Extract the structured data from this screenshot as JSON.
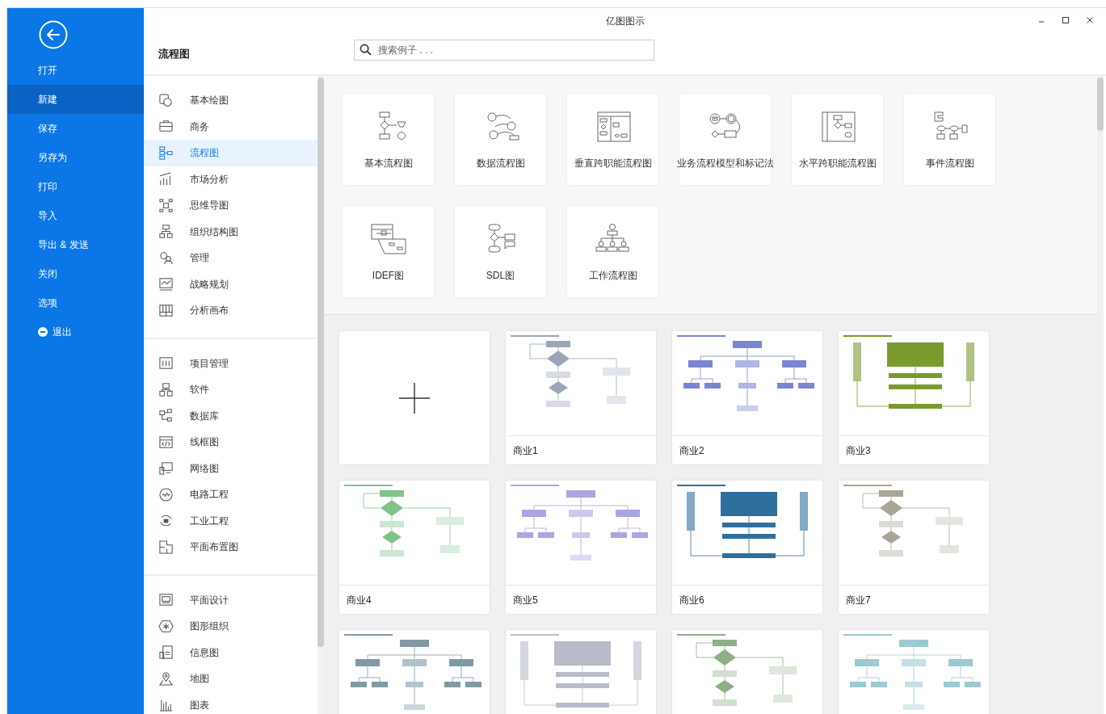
{
  "window": {
    "title": "亿图图示"
  },
  "sidebar": {
    "items": [
      {
        "label": "打开",
        "selected": false,
        "kind": "plain"
      },
      {
        "label": "新建",
        "selected": true,
        "kind": "plain"
      },
      {
        "label": "保存",
        "selected": false,
        "kind": "plain"
      },
      {
        "label": "另存为",
        "selected": false,
        "kind": "plain"
      },
      {
        "label": "打印",
        "selected": false,
        "kind": "plain"
      },
      {
        "label": "导入",
        "selected": false,
        "kind": "plain"
      },
      {
        "label": "导出 & 发送",
        "selected": false,
        "kind": "plain"
      },
      {
        "label": "关闭",
        "selected": false,
        "kind": "plain"
      },
      {
        "label": "选项",
        "selected": false,
        "kind": "plain"
      },
      {
        "label": "退出",
        "selected": false,
        "kind": "exit"
      }
    ]
  },
  "header": {
    "title": "流程图"
  },
  "search": {
    "placeholder": "搜索例子 . . ."
  },
  "category_groups": [
    {
      "items": [
        {
          "label": "基本绘图",
          "selected": false
        },
        {
          "label": "商务",
          "selected": false
        },
        {
          "label": "流程图",
          "selected": true
        },
        {
          "label": "市场分析",
          "selected": false
        },
        {
          "label": "思维导图",
          "selected": false
        },
        {
          "label": "组织结构图",
          "selected": false
        },
        {
          "label": "管理",
          "selected": false
        },
        {
          "label": "战略规划",
          "selected": false
        },
        {
          "label": "分析画布",
          "selected": false
        }
      ]
    },
    {
      "items": [
        {
          "label": "项目管理",
          "selected": false
        },
        {
          "label": "软件",
          "selected": false
        },
        {
          "label": "数据库",
          "selected": false
        },
        {
          "label": "线框图",
          "selected": false
        },
        {
          "label": "网络图",
          "selected": false
        },
        {
          "label": "电路工程",
          "selected": false
        },
        {
          "label": "工业工程",
          "selected": false
        },
        {
          "label": "平面布置图",
          "selected": false
        }
      ]
    },
    {
      "items": [
        {
          "label": "平面设计",
          "selected": false
        },
        {
          "label": "图形组织",
          "selected": false
        },
        {
          "label": "信息图",
          "selected": false
        },
        {
          "label": "地图",
          "selected": false
        },
        {
          "label": "图表",
          "selected": false
        }
      ]
    }
  ],
  "diagram_types": [
    {
      "label": "基本流程图"
    },
    {
      "label": "数据流程图"
    },
    {
      "label": "垂直跨职能流程图"
    },
    {
      "label": "业务流程模型和标记法"
    },
    {
      "label": "水平跨职能流程图"
    },
    {
      "label": "事件流程图"
    },
    {
      "label": "IDEF图"
    },
    {
      "label": "SDL图"
    },
    {
      "label": "工作流程图"
    }
  ],
  "templates": [
    {
      "kind": "blank"
    },
    {
      "kind": "template",
      "label": "商业1",
      "color": "#9aa6b8"
    },
    {
      "kind": "template",
      "label": "商业2",
      "color": "#7b86d0"
    },
    {
      "kind": "template",
      "label": "商业3",
      "color": "#7a9a2e"
    },
    {
      "kind": "template",
      "label": "商业4",
      "color": "#7fc48a"
    },
    {
      "kind": "template",
      "label": "商业5",
      "color": "#a9a6e0"
    },
    {
      "kind": "template",
      "label": "商业6",
      "color": "#2f6f9e"
    },
    {
      "kind": "template",
      "label": "商业7",
      "color": "#a8a596"
    },
    {
      "kind": "template",
      "color": "#7f9aa6"
    },
    {
      "kind": "template",
      "color": "#b8bcc8"
    },
    {
      "kind": "template",
      "color": "#8fae8a"
    },
    {
      "kind": "template",
      "color": "#9ccad3"
    }
  ]
}
